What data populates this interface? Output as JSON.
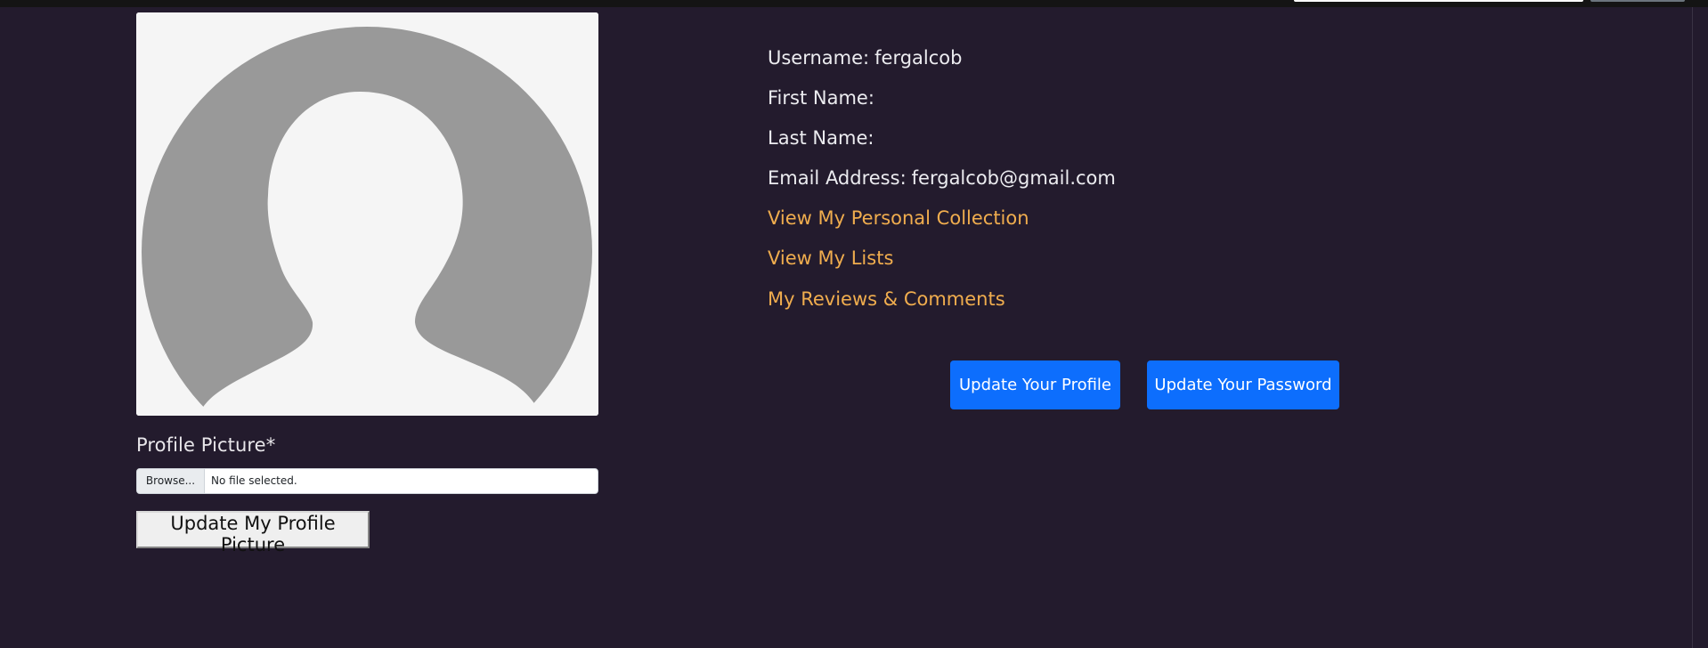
{
  "profile": {
    "username": {
      "label": "Username:",
      "value": "fergalcob"
    },
    "first_name": {
      "label": "First Name:",
      "value": ""
    },
    "last_name": {
      "label": "Last Name:",
      "value": ""
    },
    "email": {
      "label": "Email Address:",
      "value": "fergalcob@gmail.com"
    }
  },
  "links": {
    "collection": "View My Personal Collection",
    "lists": "View My Lists",
    "reviews": "My Reviews & Comments"
  },
  "actions": {
    "update_profile": "Update Your Profile",
    "update_password": "Update Your Password"
  },
  "picture_form": {
    "label": "Profile Picture*",
    "browse_label": "Browse...",
    "file_status": "No file selected.",
    "submit_label": "Update My Profile Picture"
  },
  "colors": {
    "background": "#231b2d",
    "link": "#f0ad4e",
    "primary": "#0d6efd",
    "avatar_silhouette": "#999999",
    "avatar_background": "#f5f5f5"
  },
  "icons": {
    "avatar": "default-user-silhouette-icon"
  }
}
